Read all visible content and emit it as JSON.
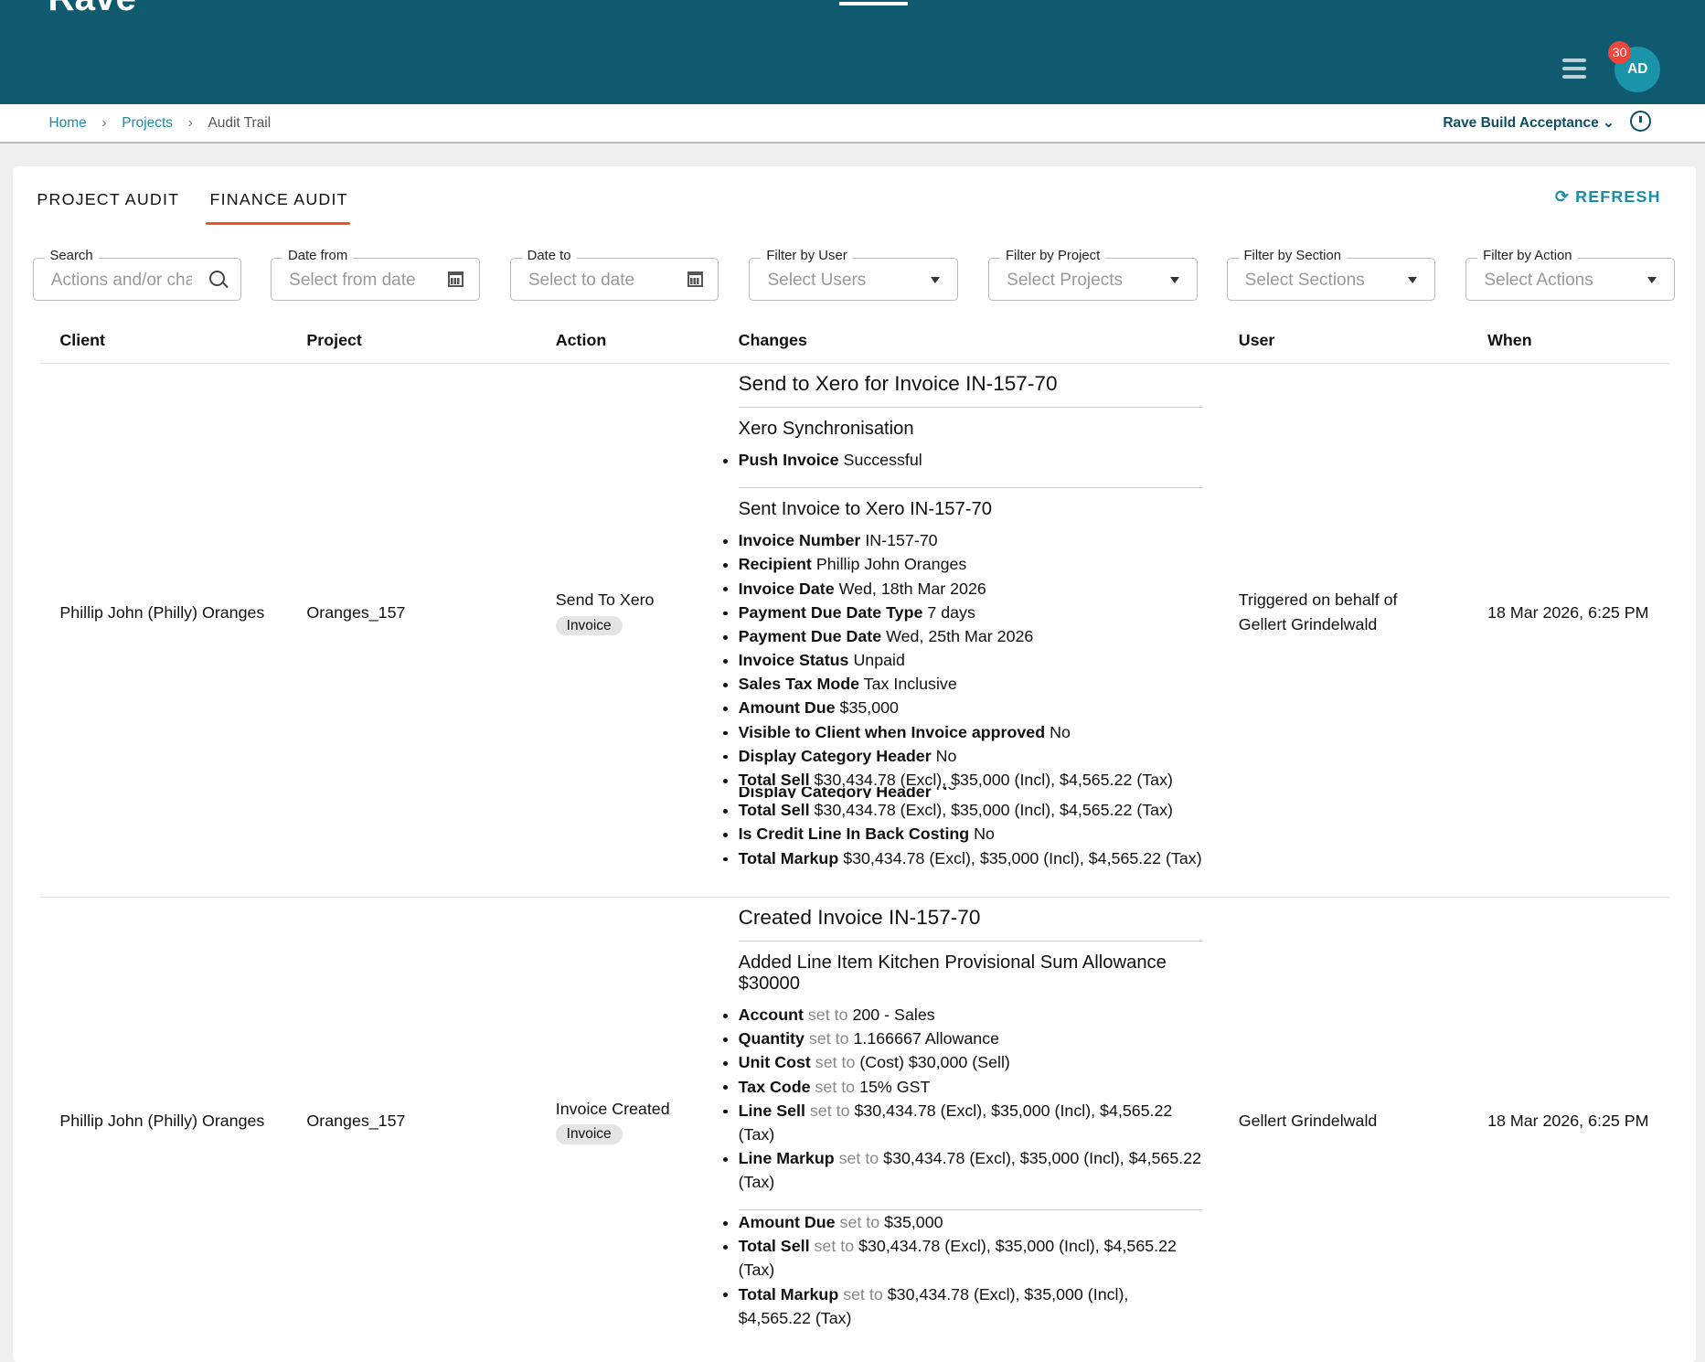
{
  "header": {
    "logo": "Rave",
    "notifications": "30",
    "avatar_initials": "AD"
  },
  "breadcrumb": [
    "Home",
    "Projects",
    "Audit Trail"
  ],
  "org_selector": "Rave Build Acceptance",
  "tabs": [
    "PROJECT AUDIT",
    "FINANCE AUDIT"
  ],
  "active_tab": "FINANCE AUDIT",
  "refresh_label": "REFRESH",
  "filters": [
    {
      "label": "Search",
      "placeholder": "Actions and/or changes"
    },
    {
      "label": "Date from",
      "placeholder": "Select from date"
    },
    {
      "label": "Date to",
      "placeholder": "Select to date"
    },
    {
      "label": "Filter by User",
      "placeholder": "Select Users"
    },
    {
      "label": "Filter by Project",
      "placeholder": "Select Projects"
    },
    {
      "label": "Filter by Section",
      "placeholder": "Select Sections"
    },
    {
      "label": "Filter by Action",
      "placeholder": "Select Actions"
    }
  ],
  "columns": [
    "Client",
    "Project",
    "Action",
    "Changes",
    "User",
    "When"
  ],
  "rows": [
    {
      "client": "Phillip John (Philly) Oranges",
      "project": "Oranges_157",
      "action": "Send To Xero",
      "tag": "Invoice",
      "user_line1": "Triggered on behalf of",
      "user_line2": "Gellert Grindelwald",
      "when": "18 Mar 2026, 6:25 PM",
      "title": "Send to Xero for Invoice IN-157-70",
      "sec1": {
        "title": "Xero Synchronisation",
        "items": [
          [
            "Push Invoice",
            "Successful"
          ]
        ]
      },
      "sec2": {
        "title": "Sent Invoice to Xero IN-157-70",
        "items": [
          [
            "Invoice Number",
            "IN-157-70"
          ],
          [
            "Recipient",
            "Phillip John Oranges"
          ],
          [
            "Invoice Date",
            "Wed, 18th Mar 2026"
          ],
          [
            "Payment Due Date Type",
            "7 days"
          ],
          [
            "Payment Due Date",
            "Wed, 25th Mar 2026"
          ],
          [
            "Invoice Status",
            "Unpaid"
          ],
          [
            "Sales Tax Mode",
            "Tax Inclusive"
          ],
          [
            "Amount Due",
            "$35,000"
          ],
          [
            "Visible to Client when Invoice approved",
            "No"
          ],
          [
            "Display Category Header",
            "No"
          ],
          [
            "Total Sell",
            "$30,434.78 (Excl), $35,000 (Incl), $4,565.22 (Tax)"
          ],
          [
            "Display Category Header",
            "No"
          ],
          [
            "Total Sell",
            "$30,434.78 (Excl), $35,000 (Incl), $4,565.22 (Tax)"
          ],
          [
            "Is Credit Line In Back Costing",
            "No"
          ],
          [
            "Total Markup",
            "$30,434.78 (Excl), $35,000 (Incl), $4,565.22 (Tax)"
          ]
        ]
      }
    },
    {
      "client": "Phillip John (Philly) Oranges",
      "project": "Oranges_157",
      "action": "Invoice Created",
      "tag": "Invoice",
      "user": "Gellert Grindelwald",
      "when": "18 Mar 2026, 6:25 PM",
      "title": "Created Invoice IN-157-70",
      "set_to": "set to",
      "sec1": {
        "title": "Added Line Item Kitchen Provisional Sum Allowance $30000",
        "items": [
          [
            "Account",
            "200 - Sales"
          ],
          [
            "Quantity",
            "1.166667 Allowance"
          ],
          [
            "Unit Cost",
            "(Cost) $30,000 (Sell)"
          ],
          [
            "Tax Code",
            "15% GST"
          ],
          [
            "Line Sell",
            "$30,434.78 (Excl), $35,000 (Incl), $4,565.22 (Tax)"
          ],
          [
            "Line Markup",
            "$30,434.78 (Excl), $35,000 (Incl), $4,565.22 (Tax)"
          ]
        ]
      },
      "sec2": {
        "items": [
          [
            "Amount Due",
            "$35,000"
          ],
          [
            "Total Sell",
            "$30,434.78 (Excl), $35,000 (Incl), $4,565.22 (Tax)"
          ],
          [
            "Total Markup",
            "$30,434.78 (Excl), $35,000 (Incl), $4,565.22 (Tax)"
          ]
        ]
      }
    }
  ]
}
